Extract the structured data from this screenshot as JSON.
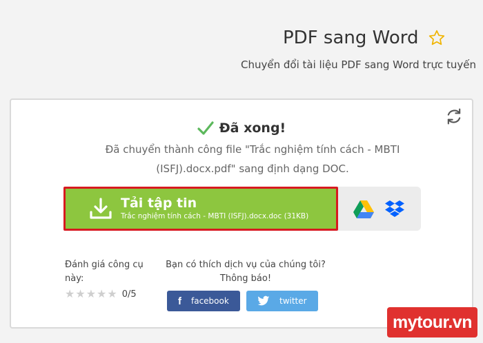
{
  "header": {
    "title": "PDF sang Word",
    "subtitle": "Chuyển đổi tài liệu PDF sang Word trực tuyến"
  },
  "result": {
    "status": "Đã xong!",
    "message_line1": "Đã chuyển thành công file \"Trắc nghiệm tính cách - MBTI",
    "message_line2": "(ISFJ).docx.pdf\" sang định dạng DOC."
  },
  "download": {
    "label": "Tải tập tin",
    "file": "Trắc nghiệm tính cách - MBTI (ISFJ).docx.doc (31KB)"
  },
  "rating": {
    "label": "Đánh giá công cụ này:",
    "value": "0/5",
    "max_stars": 5
  },
  "share": {
    "question_line1": "Bạn có thích dịch vụ của chúng tôi?",
    "question_line2": "Thông báo!",
    "facebook": "facebook",
    "twitter": "twitter"
  },
  "watermark": "mytour.vn",
  "colors": {
    "download_green": "#8dc63f",
    "highlight_red": "#d71920",
    "check_green": "#5cb85c",
    "star_gold": "#f0b400",
    "facebook_blue": "#3b5998",
    "twitter_blue": "#5aa9e6",
    "watermark_red": "#e0312f"
  }
}
